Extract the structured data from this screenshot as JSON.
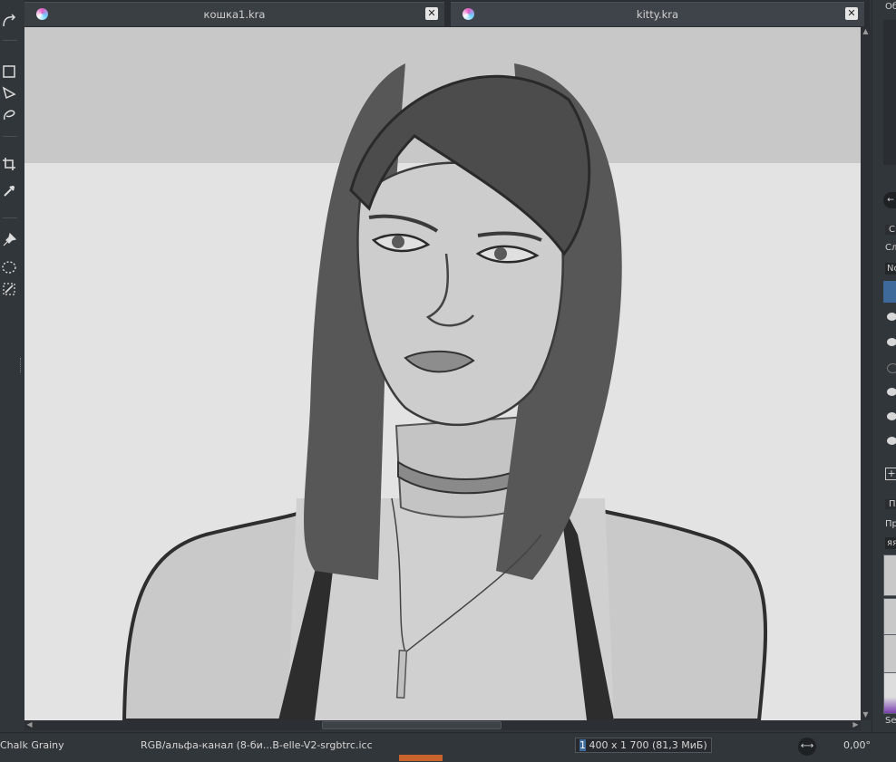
{
  "tabs": [
    {
      "label": "кошка1.kra",
      "close": "✕"
    },
    {
      "label": "kitty.kra",
      "close": "✕"
    }
  ],
  "toolbox": {
    "tools": [
      "freehand-path-icon",
      "rectangle-select-icon",
      "polygon-select-icon",
      "lasso-select-icon",
      "crop-icon",
      "color-picker-icon",
      "assistant-pin-icon",
      "elliptical-select-icon",
      "magic-select-icon"
    ]
  },
  "dock": {
    "overview_header": "Об",
    "layers_tab": "С",
    "layers_label": "Сло",
    "blend_mode": "No",
    "presets_tab": "П",
    "presets_label": "Пре",
    "preset_filter": "яя",
    "search_label": "Sea"
  },
  "status": {
    "brush": "Chalk Grainy",
    "colorspace": "RGB/альфа-канал (8-би...B-elle-V2-srgbtrc.icc",
    "size_sel": "1",
    "size_rest": " 400 x 1 700 (81,3 МиБ)",
    "rotation": "0,00°",
    "rotate_icon": "⟷"
  },
  "colors": {
    "panel": "#31363b",
    "canvas_bg": "#dcdcdc",
    "accent": "#3d6a9a",
    "orange": "#c8632c"
  }
}
